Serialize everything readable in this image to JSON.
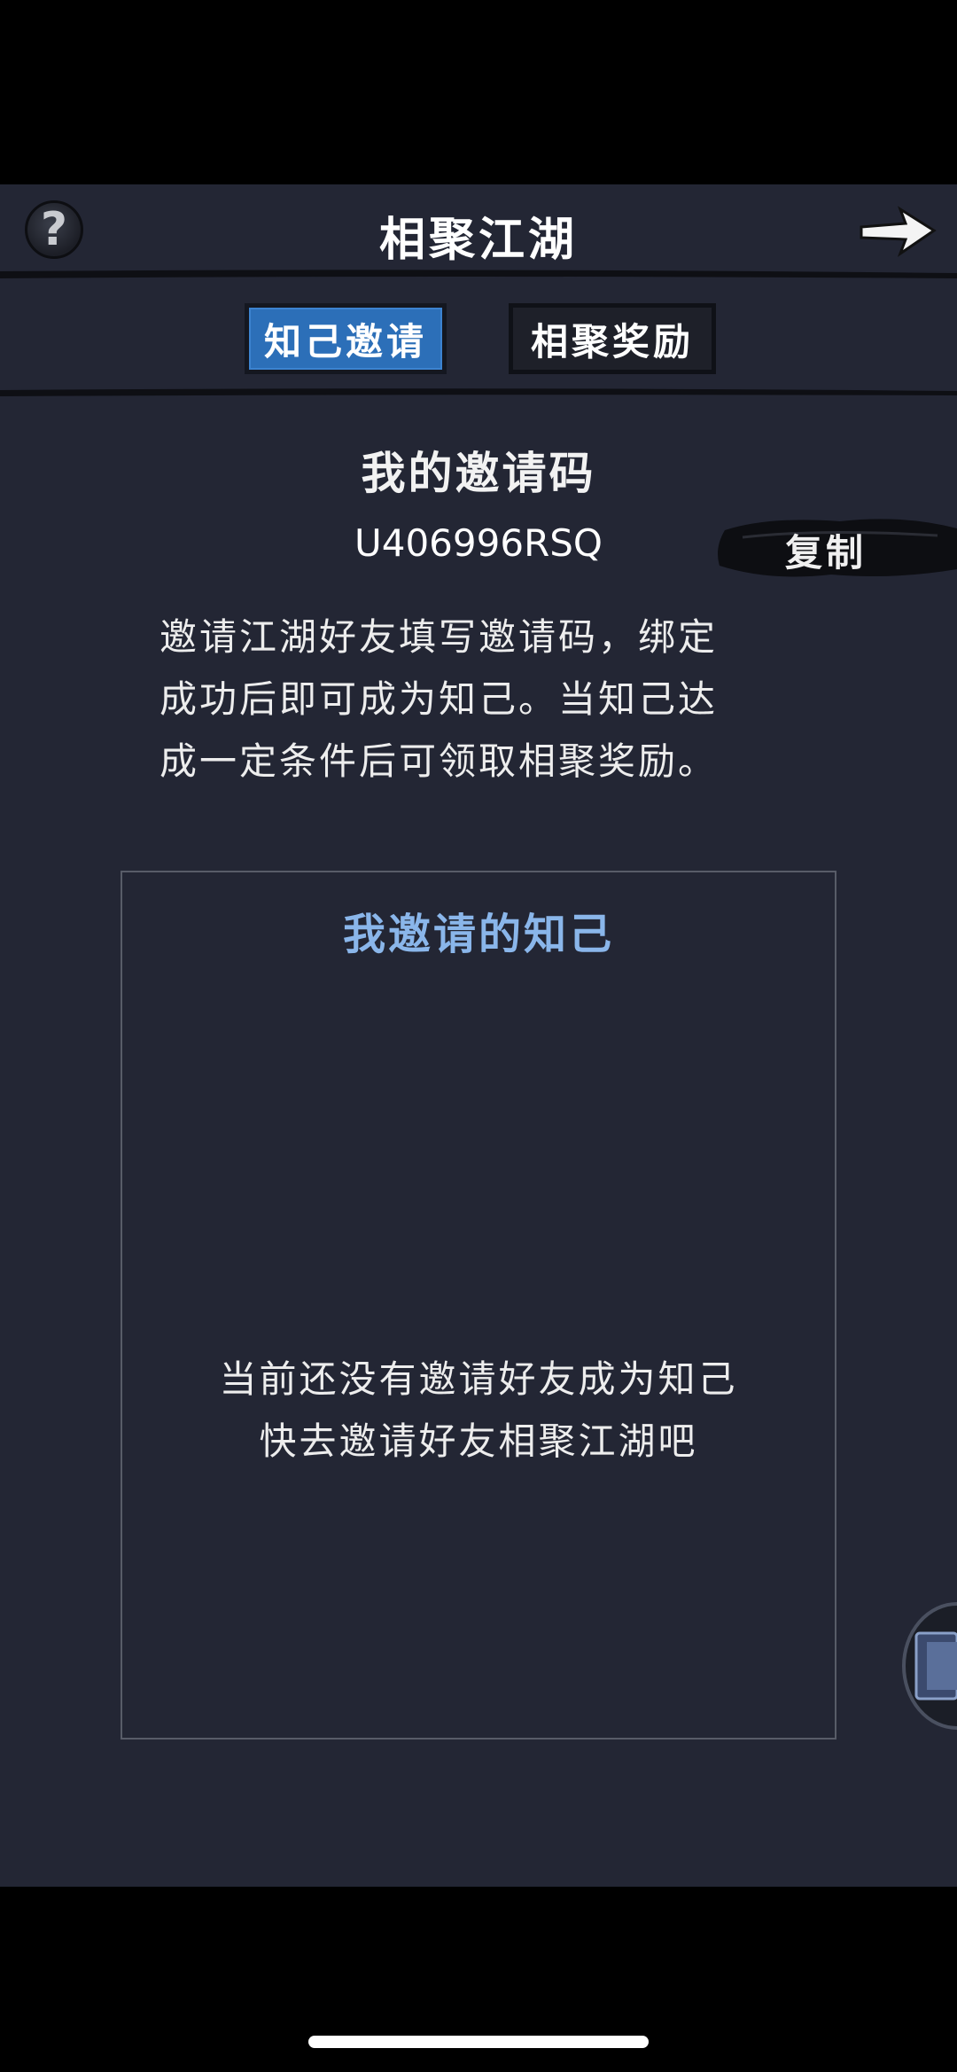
{
  "header": {
    "title": "相聚江湖",
    "help_icon": "question-mark-icon",
    "next_icon": "arrow-right-icon"
  },
  "tabs": [
    {
      "label": "知己邀请",
      "active": true
    },
    {
      "label": "相聚奖励",
      "active": false
    }
  ],
  "invite": {
    "label": "我的邀请码",
    "code": "U406996RSQ",
    "copy_label": "复制",
    "description_lines": [
      "邀请江湖好友填写邀请码，绑定",
      "成功后即可成为知己。当知己达",
      "成一定条件后可领取相聚奖励。"
    ]
  },
  "friends_panel": {
    "title": "我邀请的知己",
    "empty_line_1": "当前还没有邀请好友成为知己",
    "empty_line_2": "快去邀请好友相聚江湖吧"
  },
  "colors": {
    "background": "#232634",
    "active_tab": "#2c6fb8",
    "panel_title": "#8ab6ea"
  }
}
